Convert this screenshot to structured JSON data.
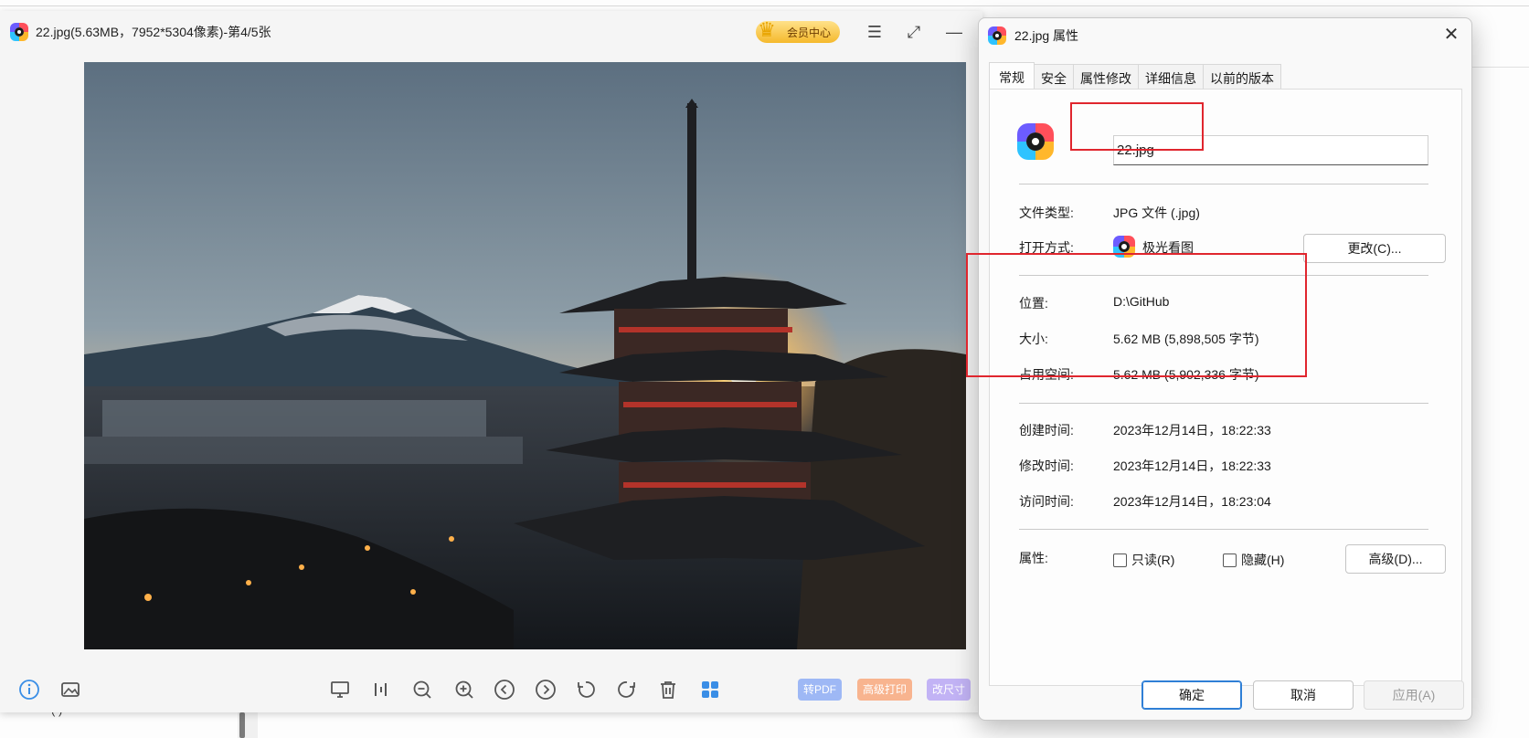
{
  "viewer": {
    "title": "22.jpg(5.63MB，7952*5304像素)-第4/5张",
    "vip_label": "会员中心",
    "pills": {
      "to_pdf": "转PDF",
      "print": "高级打印",
      "resize": "改尺寸"
    },
    "pill_colors": {
      "to_pdf": "#9eb8f5",
      "print": "#f8b48f",
      "resize": "#c2b3f5"
    }
  },
  "dialog": {
    "title": "22.jpg 属性",
    "tabs": [
      "常规",
      "安全",
      "属性修改",
      "详细信息",
      "以前的版本"
    ],
    "file_name": "22.jpg",
    "rows": {
      "file_type": {
        "label": "文件类型:",
        "value": "JPG 文件 (.jpg)"
      },
      "open_with": {
        "label": "打开方式:",
        "value": "极光看图",
        "button": "更改(C)..."
      },
      "location": {
        "label": "位置:",
        "value": "D:\\GitHub"
      },
      "size": {
        "label": "大小:",
        "value": "5.62 MB (5,898,505 字节)"
      },
      "size_on_disk": {
        "label": "占用空间:",
        "value": "5.62 MB (5,902,336 字节)"
      },
      "created": {
        "label": "创建时间:",
        "value": "2023年12月14日，18:22:33"
      },
      "modified": {
        "label": "修改时间:",
        "value": "2023年12月14日，18:22:33"
      },
      "accessed": {
        "label": "访问时间:",
        "value": "2023年12月14日，18:23:04"
      },
      "attributes": {
        "label": "属性:",
        "readonly": "只读(R)",
        "hidden": "隐藏(H)",
        "advanced": "高级(D)..."
      }
    },
    "footer": {
      "ok": "确定",
      "cancel": "取消",
      "apply": "应用(A)"
    },
    "highlight_color": "#e0262e"
  },
  "background": {
    "bottom_text": "(  )"
  }
}
